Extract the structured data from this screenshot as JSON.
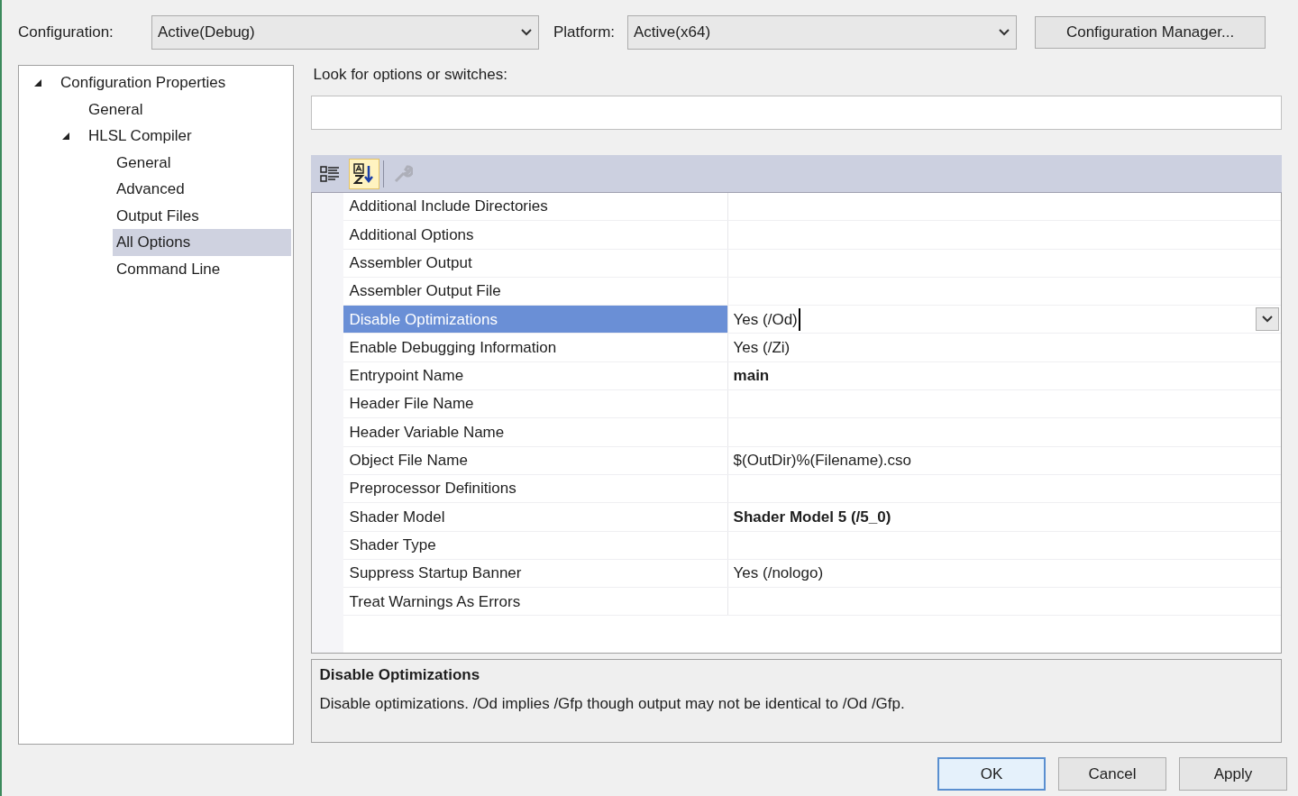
{
  "top_bar": {
    "configuration_label": "Configuration:",
    "configuration_value": "Active(Debug)",
    "platform_label": "Platform:",
    "platform_value": "Active(x64)",
    "manager_button": "Configuration Manager..."
  },
  "tree": [
    {
      "label": "Configuration Properties",
      "expanded": true,
      "selected": false,
      "children": [
        {
          "label": "General",
          "selected": false
        },
        {
          "label": "HLSL Compiler",
          "expanded": true,
          "selected": false,
          "children": [
            {
              "label": "General",
              "selected": false
            },
            {
              "label": "Advanced",
              "selected": false
            },
            {
              "label": "Output Files",
              "selected": false
            },
            {
              "label": "All Options",
              "selected": true
            },
            {
              "label": "Command Line",
              "selected": false
            }
          ]
        }
      ]
    }
  ],
  "search": {
    "label": "Look for options or switches:"
  },
  "toolbar": [
    {
      "kind": "categorized",
      "selected": false,
      "disabled": false
    },
    {
      "kind": "alphabetical",
      "selected": true,
      "disabled": false
    },
    {
      "kind": "property_pages",
      "selected": false,
      "disabled": true
    }
  ],
  "properties": [
    {
      "name": "Additional Include Directories",
      "selected": false
    },
    {
      "name": "Additional Options",
      "selected": false
    },
    {
      "name": "Assembler Output",
      "selected": false
    },
    {
      "name": "Assembler Output File",
      "selected": false
    },
    {
      "name": "Disable Optimizations",
      "value": "Yes (/Od)",
      "selected": true,
      "modified": false
    },
    {
      "name": "Enable Debugging Information",
      "value": "Yes (/Zi)",
      "selected": false,
      "modified": false
    },
    {
      "name": "Entrypoint Name",
      "value": "main",
      "selected": false,
      "modified": true
    },
    {
      "name": "Header File Name",
      "selected": false
    },
    {
      "name": "Header Variable Name",
      "selected": false
    },
    {
      "name": "Object File Name",
      "value": "$(OutDir)%(Filename).cso",
      "selected": false,
      "modified": false
    },
    {
      "name": "Preprocessor Definitions",
      "selected": false
    },
    {
      "name": "Shader Model",
      "value": "Shader Model 5 (/5_0)",
      "selected": false,
      "modified": true
    },
    {
      "name": "Shader Type",
      "selected": false
    },
    {
      "name": "Suppress Startup Banner",
      "value": "Yes (/nologo)",
      "selected": false,
      "modified": false
    },
    {
      "name": "Treat Warnings As Errors",
      "selected": false
    }
  ],
  "description": {
    "title": "Disable Optimizations",
    "text": "Disable optimizations. /Od implies /Gfp though output may not be identical to /Od /Gfp."
  },
  "buttons": [
    {
      "label": "OK",
      "default": true
    },
    {
      "label": "Cancel",
      "default": false
    },
    {
      "label": "Apply",
      "default": false
    }
  ]
}
